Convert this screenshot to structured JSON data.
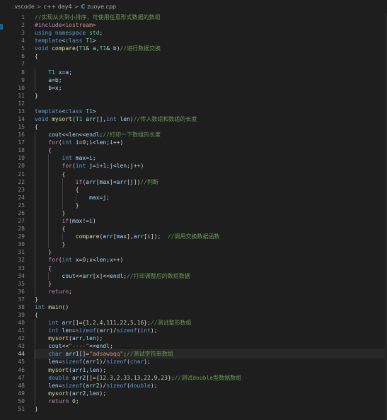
{
  "breadcrumb": {
    "items": [
      ".vscode",
      "c++ day4",
      "zuoye.cpp"
    ],
    "file_icon": "C",
    "separator": ">"
  },
  "editor": {
    "active_line": 44,
    "lines": [
      [
        [
          "com",
          "//实现从大到小排序，可使用任意形式数据的数组"
        ]
      ],
      [
        [
          "ctrl",
          "#include"
        ],
        [
          "str",
          "<iostream>"
        ]
      ],
      [
        [
          "kw",
          "using namespace "
        ],
        [
          "type",
          "std"
        ],
        [
          "txt",
          ";"
        ]
      ],
      [
        [
          "kw",
          "template"
        ],
        [
          "txt",
          "<"
        ],
        [
          "kw",
          "class "
        ],
        [
          "type",
          "T1"
        ],
        [
          "txt",
          ">"
        ]
      ],
      [
        [
          "kw",
          "void "
        ],
        [
          "fn",
          "compare"
        ],
        [
          "txt",
          "("
        ],
        [
          "type",
          "T1"
        ],
        [
          "txt",
          "& "
        ],
        [
          "var",
          "a"
        ],
        [
          "txt",
          ","
        ],
        [
          "type",
          "T1"
        ],
        [
          "txt",
          "& "
        ],
        [
          "var",
          "b"
        ],
        [
          "txt",
          ")"
        ],
        [
          "com",
          "//进行数据交换"
        ]
      ],
      [
        [
          "txt",
          "{"
        ]
      ],
      [
        [
          "txt",
          ""
        ]
      ],
      [
        [
          "txt",
          "    "
        ],
        [
          "type",
          "T1 "
        ],
        [
          "var",
          "x"
        ],
        [
          "txt",
          "="
        ],
        [
          "var",
          "a"
        ],
        [
          "txt",
          ";"
        ]
      ],
      [
        [
          "txt",
          "    "
        ],
        [
          "var",
          "a"
        ],
        [
          "txt",
          "="
        ],
        [
          "var",
          "b"
        ],
        [
          "txt",
          ";"
        ]
      ],
      [
        [
          "txt",
          "    "
        ],
        [
          "var",
          "b"
        ],
        [
          "txt",
          "="
        ],
        [
          "var",
          "x"
        ],
        [
          "txt",
          ";"
        ]
      ],
      [
        [
          "txt",
          "}"
        ]
      ],
      [
        [
          "txt",
          ""
        ]
      ],
      [
        [
          "kw",
          "template"
        ],
        [
          "txt",
          "<"
        ],
        [
          "kw",
          "class "
        ],
        [
          "type",
          "T1"
        ],
        [
          "txt",
          ">"
        ]
      ],
      [
        [
          "kw",
          "void "
        ],
        [
          "fn",
          "mysort"
        ],
        [
          "txt",
          "("
        ],
        [
          "type",
          "T1 "
        ],
        [
          "var",
          "arr"
        ],
        [
          "txt",
          "[],"
        ],
        [
          "kw",
          "int "
        ],
        [
          "var",
          "len"
        ],
        [
          "txt",
          ")"
        ],
        [
          "com",
          "//传入数组和数组的长度"
        ]
      ],
      [
        [
          "txt",
          "{"
        ]
      ],
      [
        [
          "txt",
          "    "
        ],
        [
          "var",
          "cout"
        ],
        [
          "txt",
          "<<"
        ],
        [
          "var",
          "len"
        ],
        [
          "txt",
          "<<"
        ],
        [
          "var",
          "endl"
        ],
        [
          "txt",
          ";"
        ],
        [
          "com",
          "//打印一下数组的长度"
        ]
      ],
      [
        [
          "txt",
          "    "
        ],
        [
          "ctrl",
          "for"
        ],
        [
          "txt",
          "("
        ],
        [
          "kw",
          "int "
        ],
        [
          "var",
          "i"
        ],
        [
          "txt",
          "="
        ],
        [
          "num",
          "0"
        ],
        [
          "txt",
          ";"
        ],
        [
          "var",
          "i"
        ],
        [
          "txt",
          "<"
        ],
        [
          "var",
          "len"
        ],
        [
          "txt",
          ";"
        ],
        [
          "var",
          "i"
        ],
        [
          "txt",
          "++)"
        ]
      ],
      [
        [
          "txt",
          "    {"
        ]
      ],
      [
        [
          "txt",
          "        "
        ],
        [
          "kw",
          "int "
        ],
        [
          "var",
          "max"
        ],
        [
          "txt",
          "="
        ],
        [
          "var",
          "i"
        ],
        [
          "txt",
          ";"
        ]
      ],
      [
        [
          "txt",
          "        "
        ],
        [
          "ctrl",
          "for"
        ],
        [
          "txt",
          "("
        ],
        [
          "kw",
          "int "
        ],
        [
          "var",
          "j"
        ],
        [
          "txt",
          "="
        ],
        [
          "var",
          "i"
        ],
        [
          "txt",
          "+"
        ],
        [
          "num",
          "1"
        ],
        [
          "txt",
          ";"
        ],
        [
          "var",
          "j"
        ],
        [
          "txt",
          "<"
        ],
        [
          "var",
          "len"
        ],
        [
          "txt",
          ";"
        ],
        [
          "var",
          "j"
        ],
        [
          "txt",
          "++)"
        ]
      ],
      [
        [
          "txt",
          "        {"
        ]
      ],
      [
        [
          "txt",
          "            "
        ],
        [
          "ctrl",
          "if"
        ],
        [
          "txt",
          "("
        ],
        [
          "var",
          "arr"
        ],
        [
          "txt",
          "["
        ],
        [
          "var",
          "max"
        ],
        [
          "txt",
          "]<"
        ],
        [
          "var",
          "arr"
        ],
        [
          "txt",
          "["
        ],
        [
          "var",
          "j"
        ],
        [
          "txt",
          "])"
        ],
        [
          "com",
          "//判断"
        ]
      ],
      [
        [
          "txt",
          "            {"
        ]
      ],
      [
        [
          "txt",
          "                "
        ],
        [
          "var",
          "max"
        ],
        [
          "txt",
          "="
        ],
        [
          "var",
          "j"
        ],
        [
          "txt",
          ";"
        ]
      ],
      [
        [
          "txt",
          "            }"
        ]
      ],
      [
        [
          "txt",
          "        }"
        ]
      ],
      [
        [
          "txt",
          "        "
        ],
        [
          "ctrl",
          "if"
        ],
        [
          "txt",
          "("
        ],
        [
          "var",
          "max"
        ],
        [
          "txt",
          "!="
        ],
        [
          "var",
          "i"
        ],
        [
          "txt",
          ")"
        ]
      ],
      [
        [
          "txt",
          "        {"
        ]
      ],
      [
        [
          "txt",
          "            "
        ],
        [
          "fn",
          "compare"
        ],
        [
          "txt",
          "("
        ],
        [
          "var",
          "arr"
        ],
        [
          "txt",
          "["
        ],
        [
          "var",
          "max"
        ],
        [
          "txt",
          "],"
        ],
        [
          "var",
          "arr"
        ],
        [
          "txt",
          "["
        ],
        [
          "var",
          "i"
        ],
        [
          "txt",
          "]);  "
        ],
        [
          "com",
          "//调用交换数据函数"
        ]
      ],
      [
        [
          "txt",
          "        }"
        ]
      ],
      [
        [
          "txt",
          "    }"
        ]
      ],
      [
        [
          "txt",
          "    "
        ],
        [
          "ctrl",
          "for"
        ],
        [
          "txt",
          "("
        ],
        [
          "kw",
          "int "
        ],
        [
          "var",
          "x"
        ],
        [
          "txt",
          "="
        ],
        [
          "num",
          "0"
        ],
        [
          "txt",
          ";"
        ],
        [
          "var",
          "x"
        ],
        [
          "txt",
          "<"
        ],
        [
          "var",
          "len"
        ],
        [
          "txt",
          ";"
        ],
        [
          "var",
          "x"
        ],
        [
          "txt",
          "++)"
        ]
      ],
      [
        [
          "txt",
          "    {"
        ]
      ],
      [
        [
          "txt",
          "        "
        ],
        [
          "var",
          "cout"
        ],
        [
          "txt",
          "<<"
        ],
        [
          "var",
          "arr"
        ],
        [
          "txt",
          "["
        ],
        [
          "var",
          "x"
        ],
        [
          "txt",
          "]<<"
        ],
        [
          "var",
          "endl"
        ],
        [
          "txt",
          ";"
        ],
        [
          "com",
          "//打印调整后的数组数据"
        ]
      ],
      [
        [
          "txt",
          "    }"
        ]
      ],
      [
        [
          "txt",
          "    "
        ],
        [
          "ctrl",
          "return"
        ],
        [
          "txt",
          ";"
        ]
      ],
      [
        [
          "txt",
          "}"
        ]
      ],
      [
        [
          "kw",
          "int "
        ],
        [
          "fn",
          "main"
        ],
        [
          "txt",
          "()"
        ]
      ],
      [
        [
          "txt",
          "{"
        ]
      ],
      [
        [
          "txt",
          "    "
        ],
        [
          "kw",
          "int "
        ],
        [
          "var",
          "arr"
        ],
        [
          "txt",
          "[]={"
        ],
        [
          "num",
          "1"
        ],
        [
          "txt",
          ","
        ],
        [
          "num",
          "2"
        ],
        [
          "txt",
          ","
        ],
        [
          "num",
          "4"
        ],
        [
          "txt",
          ","
        ],
        [
          "num",
          "111"
        ],
        [
          "txt",
          ","
        ],
        [
          "num",
          "22"
        ],
        [
          "txt",
          ","
        ],
        [
          "num",
          "5"
        ],
        [
          "txt",
          ","
        ],
        [
          "num",
          "16"
        ],
        [
          "txt",
          "};"
        ],
        [
          "com",
          "//测试整形数组"
        ]
      ],
      [
        [
          "txt",
          "    "
        ],
        [
          "kw",
          "int "
        ],
        [
          "var",
          "len"
        ],
        [
          "txt",
          "="
        ],
        [
          "kw",
          "sizeof"
        ],
        [
          "txt",
          "("
        ],
        [
          "var",
          "arr"
        ],
        [
          "txt",
          ")/"
        ],
        [
          "kw",
          "sizeof"
        ],
        [
          "txt",
          "("
        ],
        [
          "kw",
          "int"
        ],
        [
          "txt",
          ");"
        ]
      ],
      [
        [
          "txt",
          "    "
        ],
        [
          "fn",
          "mysort"
        ],
        [
          "txt",
          "("
        ],
        [
          "var",
          "arr"
        ],
        [
          "txt",
          ","
        ],
        [
          "var",
          "len"
        ],
        [
          "txt",
          ");"
        ]
      ],
      [
        [
          "txt",
          "    "
        ],
        [
          "var",
          "cout"
        ],
        [
          "txt",
          "<<"
        ],
        [
          "str",
          "\"----\""
        ],
        [
          "txt",
          "<<"
        ],
        [
          "var",
          "endl"
        ],
        [
          "txt",
          ";"
        ]
      ],
      [
        [
          "txt",
          "    "
        ],
        [
          "kw",
          "char "
        ],
        [
          "var",
          "arr1"
        ],
        [
          "txt",
          "[]="
        ],
        [
          "str",
          "\"adsawaqq\""
        ],
        [
          "txt",
          ";"
        ],
        [
          "com",
          "//测试字符串数组"
        ]
      ],
      [
        [
          "txt",
          "    "
        ],
        [
          "var",
          "len"
        ],
        [
          "txt",
          "="
        ],
        [
          "kw",
          "sizeof"
        ],
        [
          "txt",
          "("
        ],
        [
          "var",
          "arr1"
        ],
        [
          "txt",
          ")/"
        ],
        [
          "kw",
          "sizeof"
        ],
        [
          "txt",
          "("
        ],
        [
          "kw",
          "char"
        ],
        [
          "txt",
          ");"
        ]
      ],
      [
        [
          "txt",
          "    "
        ],
        [
          "fn",
          "mysort"
        ],
        [
          "txt",
          "("
        ],
        [
          "var",
          "arr1"
        ],
        [
          "txt",
          ","
        ],
        [
          "var",
          "len"
        ],
        [
          "txt",
          ");"
        ]
      ],
      [
        [
          "txt",
          "    "
        ],
        [
          "kw",
          "double "
        ],
        [
          "var",
          "arr2"
        ],
        [
          "txt",
          "[]={"
        ],
        [
          "num",
          "12.3"
        ],
        [
          "txt",
          ","
        ],
        [
          "num",
          "2.33"
        ],
        [
          "txt",
          ","
        ],
        [
          "num",
          "13"
        ],
        [
          "txt",
          ","
        ],
        [
          "num",
          "22"
        ],
        [
          "txt",
          ","
        ],
        [
          "num",
          "9"
        ],
        [
          "txt",
          ","
        ],
        [
          "num",
          "23"
        ],
        [
          "txt",
          "};"
        ],
        [
          "com",
          "//测试double型数据数组"
        ]
      ],
      [
        [
          "txt",
          "    "
        ],
        [
          "var",
          "len"
        ],
        [
          "txt",
          "="
        ],
        [
          "kw",
          "sizeof"
        ],
        [
          "txt",
          "("
        ],
        [
          "var",
          "arr2"
        ],
        [
          "txt",
          ")/"
        ],
        [
          "kw",
          "sizeof"
        ],
        [
          "txt",
          "("
        ],
        [
          "kw",
          "double"
        ],
        [
          "txt",
          ");"
        ]
      ],
      [
        [
          "txt",
          "    "
        ],
        [
          "fn",
          "mysort"
        ],
        [
          "txt",
          "("
        ],
        [
          "var",
          "arr2"
        ],
        [
          "txt",
          ","
        ],
        [
          "var",
          "len"
        ],
        [
          "txt",
          ");"
        ]
      ],
      [
        [
          "txt",
          "    "
        ],
        [
          "ctrl",
          "return "
        ],
        [
          "num",
          "0"
        ],
        [
          "txt",
          ";"
        ]
      ],
      [
        [
          "txt",
          "}"
        ]
      ]
    ]
  }
}
